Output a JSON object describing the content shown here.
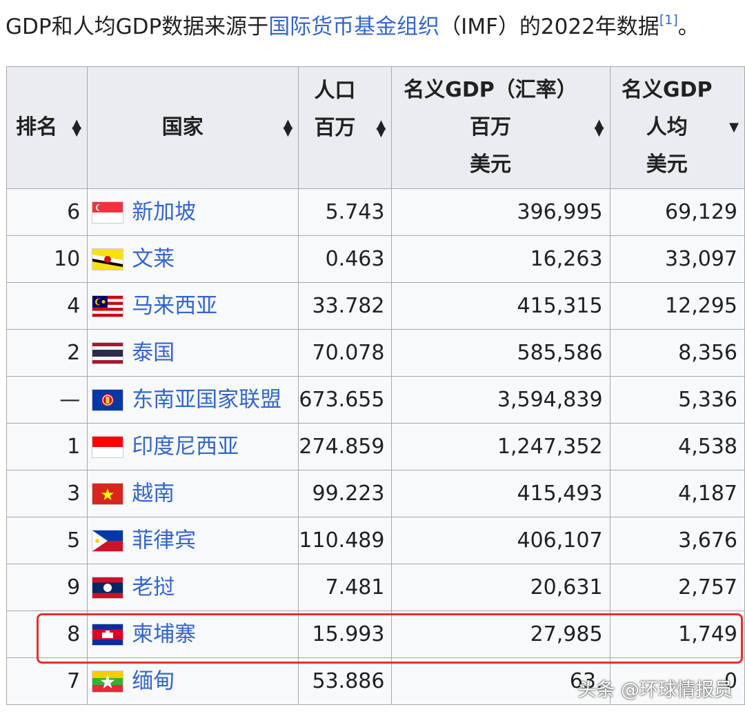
{
  "intro": {
    "text_before": "GDP和人均GDP数据来源于",
    "link": "国际货币基金组织",
    "text_after": "（IMF）的2022年数据",
    "ref": "[1]",
    "end": "。"
  },
  "table": {
    "headers": {
      "rank": "排名",
      "country": "国家",
      "pop_line1": "人口",
      "pop_line2": "百万",
      "gdp_line1": "名义GDP（汇率）",
      "gdp_line2": "百万",
      "gdp_line3": "美元",
      "pc_line1": "名义GDP",
      "pc_line2": "人均",
      "pc_line3": "美元"
    },
    "rows": [
      {
        "rank": "6",
        "country": "新加坡",
        "flag": "singapore-flag",
        "pop": "5.743",
        "gdp": "396,995",
        "pc": "69,129"
      },
      {
        "rank": "10",
        "country": "文莱",
        "flag": "brunei-flag",
        "pop": "0.463",
        "gdp": "16,263",
        "pc": "33,097"
      },
      {
        "rank": "4",
        "country": "马来西亚",
        "flag": "malaysia-flag",
        "pop": "33.782",
        "gdp": "415,315",
        "pc": "12,295"
      },
      {
        "rank": "2",
        "country": "泰国",
        "flag": "thailand-flag",
        "pop": "70.078",
        "gdp": "585,586",
        "pc": "8,356"
      },
      {
        "rank": "—",
        "country": "东南亚国家联盟",
        "flag": "asean-flag",
        "pop": "673.655",
        "gdp": "3,594,839",
        "pc": "5,336"
      },
      {
        "rank": "1",
        "country": "印度尼西亚",
        "flag": "indonesia-flag",
        "pop": "274.859",
        "gdp": "1,247,352",
        "pc": "4,538"
      },
      {
        "rank": "3",
        "country": "越南",
        "flag": "vietnam-flag",
        "pop": "99.223",
        "gdp": "415,493",
        "pc": "4,187"
      },
      {
        "rank": "5",
        "country": "菲律宾",
        "flag": "philippines-flag",
        "pop": "110.489",
        "gdp": "406,107",
        "pc": "3,676"
      },
      {
        "rank": "9",
        "country": "老挝",
        "flag": "laos-flag",
        "pop": "7.481",
        "gdp": "20,631",
        "pc": "2,757"
      },
      {
        "rank": "8",
        "country": "柬埔寨",
        "flag": "cambodia-flag",
        "pop": "15.993",
        "gdp": "27,985",
        "pc": "1,749"
      },
      {
        "rank": "7",
        "country": "缅甸",
        "flag": "myanmar-flag",
        "pop": "53.886",
        "gdp": "63,",
        "pc": "0"
      }
    ],
    "highlighted_country": "柬埔寨"
  },
  "watermark": "头条 @环球情报员",
  "colors": {
    "link": "#3366cc",
    "header_bg": "#eaecf0",
    "cell_bg": "#f8f9fa",
    "border": "#a2a9b1",
    "highlight": "#e03030"
  }
}
